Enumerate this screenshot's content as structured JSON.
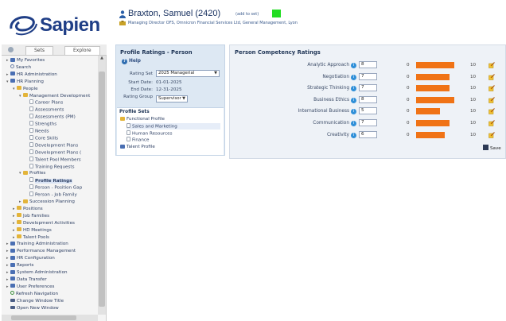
{
  "brand": {
    "name": "Sapien"
  },
  "header": {
    "person_name": "Braxton, Samuel (2420)",
    "add_to_set": "(add to set)",
    "subtitle": "Managing Director OFS, Omnicron Financial Services Ltd, General Management, Lyon",
    "status_color": "#22dd22"
  },
  "nav_tabs": {
    "sets": "Sets",
    "explore": "Explore"
  },
  "tree": [
    {
      "label": "My Favorites",
      "icon": "blue",
      "indent": 0,
      "toggle": "+"
    },
    {
      "label": "Search",
      "icon": "search",
      "indent": 0,
      "toggle": ""
    },
    {
      "label": "HR Administration",
      "icon": "blue",
      "indent": 0,
      "toggle": "+"
    },
    {
      "label": "HR Planning",
      "icon": "blue",
      "indent": 0,
      "toggle": "-"
    },
    {
      "label": "People",
      "icon": "folder",
      "indent": 1,
      "toggle": "-"
    },
    {
      "label": "Management Development",
      "icon": "folder",
      "indent": 2,
      "toggle": "-"
    },
    {
      "label": "Career Plans",
      "icon": "doc",
      "indent": 3,
      "toggle": ""
    },
    {
      "label": "Assessments",
      "icon": "doc",
      "indent": 3,
      "toggle": ""
    },
    {
      "label": "Assessments (PM)",
      "icon": "doc",
      "indent": 3,
      "toggle": ""
    },
    {
      "label": "Strengths",
      "icon": "doc",
      "indent": 3,
      "toggle": ""
    },
    {
      "label": "Needs",
      "icon": "doc",
      "indent": 3,
      "toggle": ""
    },
    {
      "label": "Core Skills",
      "icon": "doc",
      "indent": 3,
      "toggle": ""
    },
    {
      "label": "Development Plans",
      "icon": "doc",
      "indent": 3,
      "toggle": ""
    },
    {
      "label": "Development Plans (",
      "icon": "doc",
      "indent": 3,
      "toggle": ""
    },
    {
      "label": "Talent Pool Members",
      "icon": "doc",
      "indent": 3,
      "toggle": ""
    },
    {
      "label": "Training Requests",
      "icon": "doc",
      "indent": 3,
      "toggle": ""
    },
    {
      "label": "Profiles",
      "icon": "folder",
      "indent": 2,
      "toggle": "-"
    },
    {
      "label": "Profile Ratings",
      "icon": "doc",
      "indent": 3,
      "toggle": "",
      "selected": true
    },
    {
      "label": "Person - Position Gap",
      "icon": "doc",
      "indent": 3,
      "toggle": ""
    },
    {
      "label": "Person - Job Family",
      "icon": "doc",
      "indent": 3,
      "toggle": ""
    },
    {
      "label": "Succession Planning",
      "icon": "folder",
      "indent": 2,
      "toggle": "+"
    },
    {
      "label": "Positions",
      "icon": "folder",
      "indent": 1,
      "toggle": "+"
    },
    {
      "label": "Job Families",
      "icon": "folder",
      "indent": 1,
      "toggle": "+"
    },
    {
      "label": "Development Activities",
      "icon": "folder",
      "indent": 1,
      "toggle": "+"
    },
    {
      "label": "HD Meetings",
      "icon": "folder",
      "indent": 1,
      "toggle": "+"
    },
    {
      "label": "Talent Pools",
      "icon": "folder",
      "indent": 1,
      "toggle": "+"
    },
    {
      "label": "Training Administration",
      "icon": "blue",
      "indent": 0,
      "toggle": "+"
    },
    {
      "label": "Performance Management",
      "icon": "blue",
      "indent": 0,
      "toggle": "+"
    },
    {
      "label": "HR Configuration",
      "icon": "blue",
      "indent": 0,
      "toggle": "+"
    },
    {
      "label": "Reports",
      "icon": "blue",
      "indent": 0,
      "toggle": "+"
    },
    {
      "label": "System Administration",
      "icon": "blue",
      "indent": 0,
      "toggle": "+"
    },
    {
      "label": "Data Transfer",
      "icon": "blue",
      "indent": 0,
      "toggle": "+"
    },
    {
      "label": "User Preferences",
      "icon": "blue",
      "indent": 0,
      "toggle": "+"
    },
    {
      "label": "Refresh Navigation",
      "icon": "refresh",
      "indent": 0,
      "toggle": ""
    },
    {
      "label": "Change Window Title",
      "icon": "window",
      "indent": 0,
      "toggle": ""
    },
    {
      "label": "Open New Window",
      "icon": "window",
      "indent": 0,
      "toggle": ""
    }
  ],
  "profile_ratings": {
    "title": "Profile Ratings - Person",
    "help": "Help",
    "rating_set_label": "Rating Set",
    "rating_set_value": "2025 Managerial",
    "start_date_label": "Start Date:",
    "start_date": "01-01-2025",
    "end_date_label": "End Date:",
    "end_date": "12-31-2025",
    "rating_group_label": "Rating Group",
    "rating_group_value": "Supervisor"
  },
  "profile_sets": {
    "title": "Profile Sets",
    "items": [
      {
        "label": "Functional Profile",
        "icon": "folder",
        "indent": 0
      },
      {
        "label": "Sales and Marketing",
        "icon": "doc",
        "indent": 1,
        "selected": true
      },
      {
        "label": "Human Resources",
        "icon": "doc",
        "indent": 1
      },
      {
        "label": "Finance",
        "icon": "doc",
        "indent": 1
      },
      {
        "label": "Talent Profile",
        "icon": "blue",
        "indent": 0
      }
    ]
  },
  "competency": {
    "title": "Person Competency Ratings",
    "min_label": "0",
    "max_label": "10",
    "max_value": 10,
    "bar_color": "#f07316",
    "save_label": "Save",
    "rows": [
      {
        "label": "Analytic Approach",
        "value": 8
      },
      {
        "label": "Negotiation",
        "value": 7
      },
      {
        "label": "Strategic Thinking",
        "value": 7
      },
      {
        "label": "Business Ethics",
        "value": 8
      },
      {
        "label": "International Business",
        "value": 5
      },
      {
        "label": "Communication",
        "value": 7
      },
      {
        "label": "Creativity",
        "value": 6
      }
    ]
  }
}
